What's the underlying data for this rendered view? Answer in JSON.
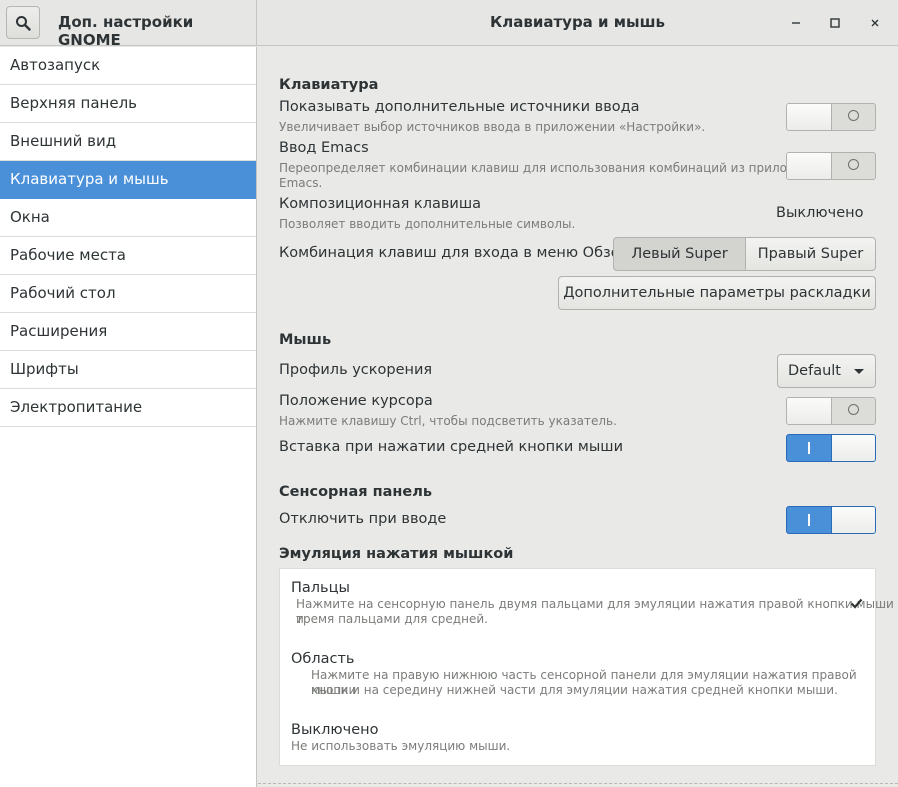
{
  "header": {
    "app_title": "Доп. настройки GNOME",
    "page_title": "Клавиатура и мышь",
    "search_icon": "search-icon",
    "minimize_icon": "minimize-icon",
    "maximize_icon": "maximize-icon",
    "close_icon": "close-icon"
  },
  "sidebar": {
    "items": [
      {
        "label": "Автозапуск"
      },
      {
        "label": "Верхняя панель"
      },
      {
        "label": "Внешний вид"
      },
      {
        "label": "Клавиатура и мышь",
        "active": true
      },
      {
        "label": "Окна"
      },
      {
        "label": "Рабочие места"
      },
      {
        "label": "Рабочий стол"
      },
      {
        "label": "Расширения"
      },
      {
        "label": "Шрифты"
      },
      {
        "label": "Электропитание"
      }
    ]
  },
  "keyboard": {
    "heading": "Клавиатура",
    "extra_sources": {
      "title": "Показывать дополнительные источники ввода",
      "desc": "Увеличивает выбор источников ввода в приложении «Настройки».",
      "on": false
    },
    "emacs": {
      "title": "Ввод Emacs",
      "desc_1": "Переопределяет комбинации клавиш для использования комбинаций из приложения",
      "desc_2": "Emacs.",
      "on": false
    },
    "compose": {
      "title": "Композиционная клавиша",
      "desc": "Позволяет вводить дополнительные символы.",
      "value": "Выключено"
    },
    "overview": {
      "title": "Комбинация клавиш для входа в меню Обзор",
      "left": "Левый Super",
      "right": "Правый Super",
      "selected": "Левый Super"
    },
    "layout_button": "Дополнительные параметры раскладки"
  },
  "mouse": {
    "heading": "Мышь",
    "accel": {
      "title": "Профиль ускорения",
      "value": "Default"
    },
    "locate": {
      "title": "Положение курсора",
      "desc": "Нажмите клавишу Ctrl, чтобы подсветить указатель.",
      "on": false
    },
    "middle_paste": {
      "title": "Вставка при нажатии средней кнопки мыши",
      "on": true
    }
  },
  "touchpad": {
    "heading": "Сенсорная панель",
    "disable_typing": {
      "title": "Отключить при вводе",
      "on": true
    }
  },
  "emulation": {
    "heading": "Эмуляция нажатия мышкой",
    "options": [
      {
        "title": "Пальцы",
        "desc_1": "Нажмите на сенсорную панель двумя пальцами для эмуляции нажатия правой кнопки мыши и",
        "desc_2": "тремя пальцами для средней.",
        "selected": true
      },
      {
        "title": "Область",
        "desc_1": "Нажмите на правую нижнюю часть сенсорной панели для эмуляции нажатия правой кнопки",
        "desc_2": "мыши и на середину нижней части для эмуляции нажатия средней кнопки мыши.",
        "selected": false
      },
      {
        "title": "Выключено",
        "desc_1": "Не использовать эмуляцию мыши.",
        "selected": false
      }
    ]
  },
  "colors": {
    "accent": "#4a90d9",
    "background": "#e9e9e7",
    "sidebar": "#ffffff"
  }
}
